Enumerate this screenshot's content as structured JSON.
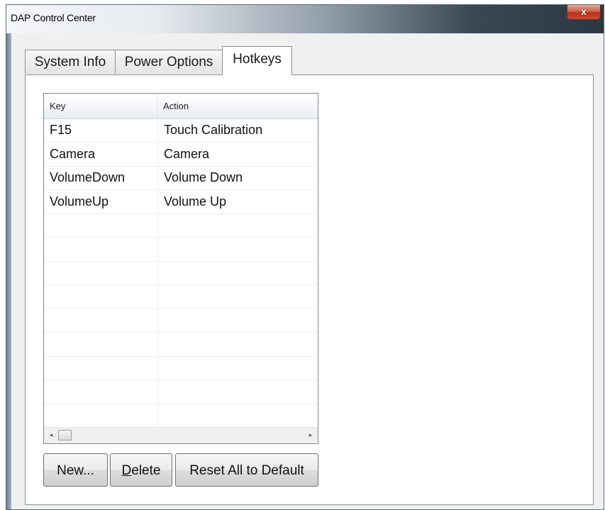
{
  "window": {
    "title": "DAP Control Center",
    "close_label": "x"
  },
  "tabs": [
    {
      "label": "System Info",
      "active": false
    },
    {
      "label": "Power Options",
      "active": false
    },
    {
      "label": "Hotkeys",
      "active": true
    }
  ],
  "hotkeys": {
    "columns": [
      "Key",
      "Action"
    ],
    "rows": [
      {
        "key": "F15",
        "action": "Touch Calibration"
      },
      {
        "key": "Camera",
        "action": "Camera"
      },
      {
        "key": "VolumeDown",
        "action": "Volume Down"
      },
      {
        "key": "VolumeUp",
        "action": "Volume Up"
      }
    ],
    "empty_rows": 9,
    "scroll_left_icon": "◂",
    "scroll_right_icon": "▸"
  },
  "buttons": {
    "new_label": "New...",
    "delete_mnemonic": "D",
    "delete_rest": "elete",
    "reset_label": "Reset All to Default"
  },
  "colors": {
    "panel_bg": "#ffffff",
    "window_bg": "#f0f0f0",
    "close_red": "#c94a30"
  }
}
